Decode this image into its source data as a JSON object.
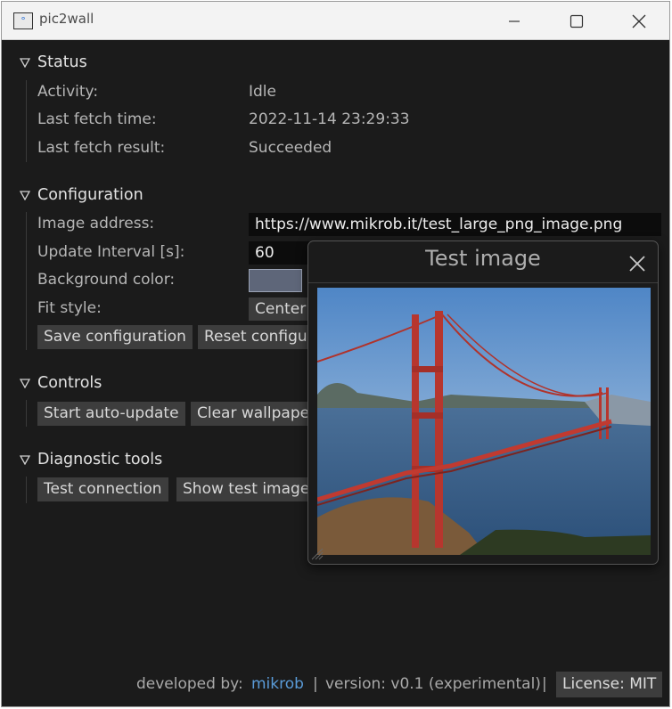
{
  "window": {
    "title": "pic2wall",
    "icon_text": "[°]"
  },
  "status": {
    "heading": "Status",
    "activity_label": "Activity:",
    "activity_value": "Idle",
    "fetch_time_label": "Last fetch time:",
    "fetch_time_value": "2022-11-14 23:29:33",
    "fetch_result_label": "Last fetch result:",
    "fetch_result_value": "Succeeded"
  },
  "config": {
    "heading": "Configuration",
    "address_label": "Image address:",
    "address_value": "https://www.mikrob.it/test_large_png_image.png",
    "interval_label": "Update Interval [s]:",
    "interval_value": "60",
    "bg_label": "Background color:",
    "bg_color": "#5e6679",
    "fit_label": "Fit style:",
    "fit_value": "Center",
    "save_label": "Save configuration",
    "reset_label": "Reset configuration"
  },
  "controls": {
    "heading": "Controls",
    "start_label": "Start auto-update",
    "clear_label": "Clear wallpaper"
  },
  "diagnostic": {
    "heading": "Diagnostic tools",
    "test_label": "Test connection",
    "show_label": "Show test image"
  },
  "popup": {
    "title": "Test image",
    "image_subject": "golden-gate-bridge-photo"
  },
  "footer": {
    "developed_by": "developed by:",
    "author": "mikrob",
    "sep1": "|",
    "version": "version: v0.1 (experimental)",
    "sep2": "|",
    "license": "License: MIT"
  }
}
